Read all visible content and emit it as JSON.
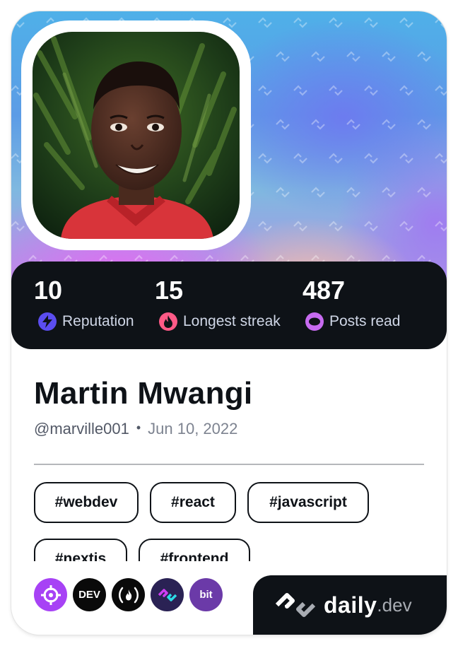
{
  "profile": {
    "name": "Martin Mwangi",
    "handle": "@marville001",
    "separator": "•",
    "joined": "Jun 10, 2022"
  },
  "stats": [
    {
      "value": "10",
      "label": "Reputation",
      "icon": "bolt-icon",
      "color": "#5b4df0"
    },
    {
      "value": "15",
      "label": "Longest streak",
      "icon": "flame-icon",
      "color": "#ff5a87"
    },
    {
      "value": "487",
      "label": "Posts read",
      "icon": "eye-icon",
      "color": "#c76bf0"
    }
  ],
  "tags": [
    "#webdev",
    "#react",
    "#javascript",
    "#nextjs",
    "#frontend"
  ],
  "sources": [
    {
      "name": "crosshair-source-icon",
      "color": "#a742f5",
      "text": ""
    },
    {
      "name": "dev-source-icon",
      "color": "#0a0a0a",
      "text": "DEV"
    },
    {
      "name": "freecodecamp-source-icon",
      "color": "#0a0a0a",
      "text": "(🔥)"
    },
    {
      "name": "daily-source-icon",
      "color": "#2a2254",
      "text": ""
    },
    {
      "name": "bit-source-icon",
      "color": "#6b3aa8",
      "text": "bit"
    }
  ],
  "brand": {
    "daily": "daily",
    "dev": ".dev"
  },
  "colors": {
    "dark": "#0e1217",
    "accent": "#a742f5"
  }
}
